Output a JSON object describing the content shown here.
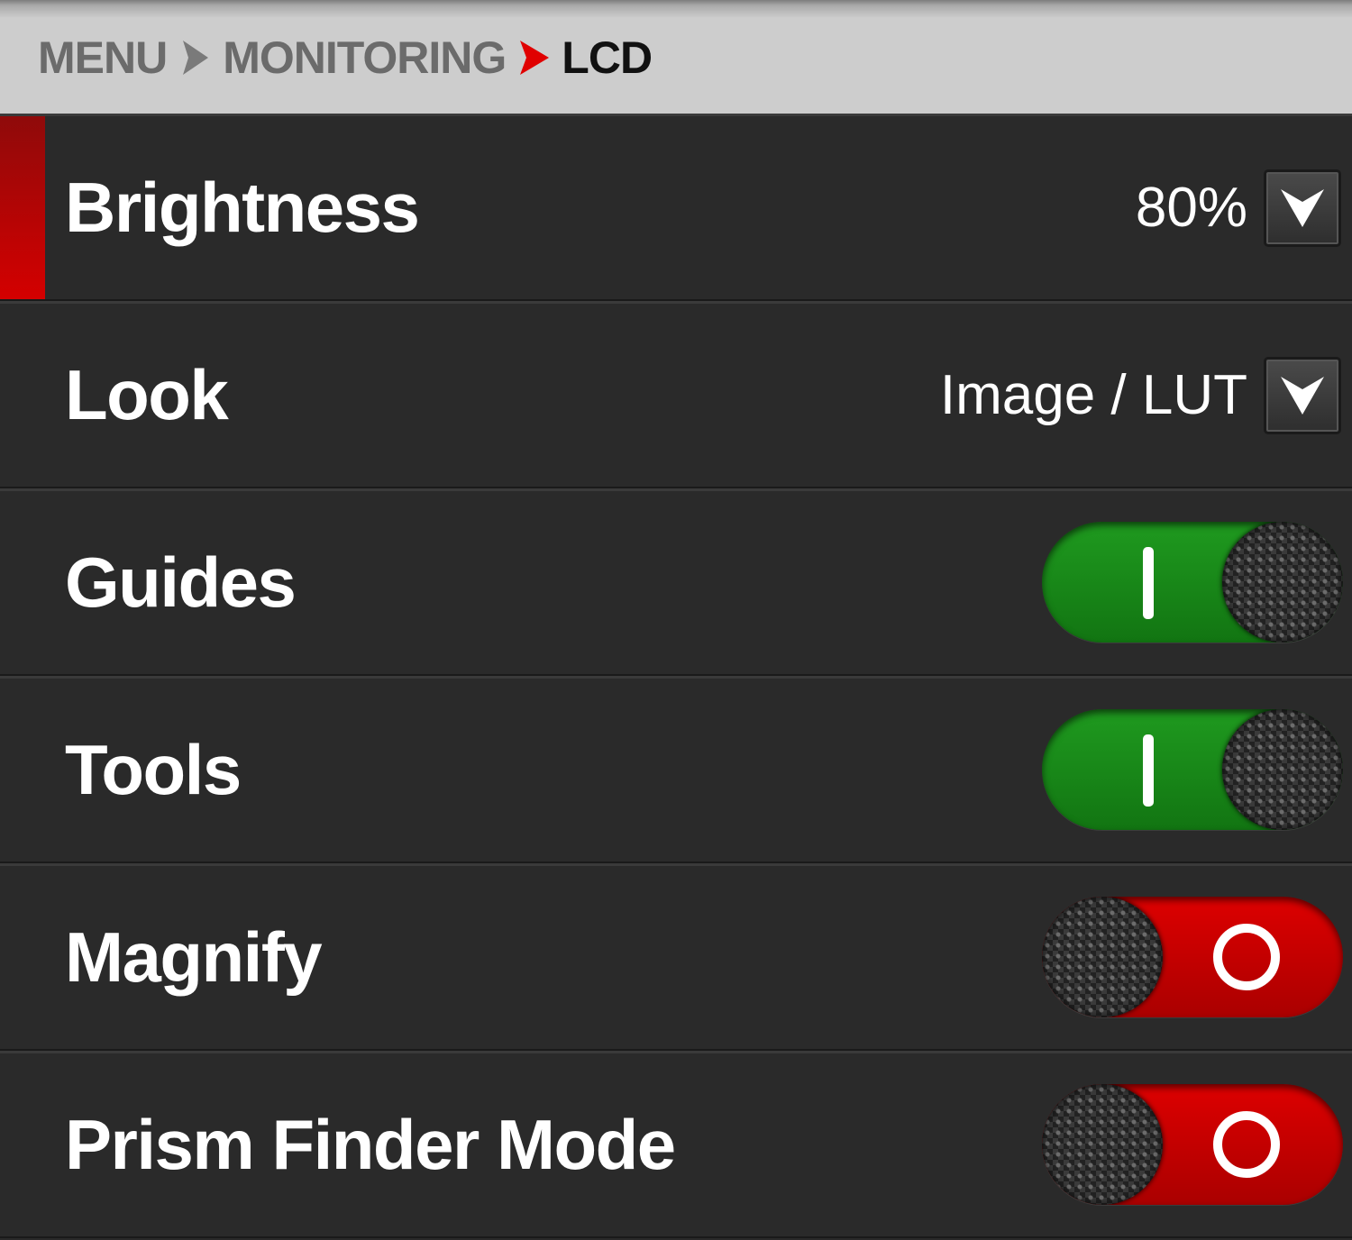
{
  "breadcrumb": {
    "items": [
      "MENU",
      "MONITORING",
      "LCD"
    ],
    "separator_icons": [
      "chevron-right-icon",
      "chevron-right-red-icon"
    ]
  },
  "colors": {
    "active_accent": "#d40000",
    "toggle_on": "#1a8a1a",
    "toggle_off": "#cc0000",
    "background": "#2a2a2a"
  },
  "settings": [
    {
      "label": "Brightness",
      "type": "dropdown",
      "value": "80%",
      "selected": true
    },
    {
      "label": "Look",
      "type": "dropdown",
      "value": "Image / LUT",
      "selected": false
    },
    {
      "label": "Guides",
      "type": "toggle",
      "state": "on"
    },
    {
      "label": "Tools",
      "type": "toggle",
      "state": "on"
    },
    {
      "label": "Magnify",
      "type": "toggle",
      "state": "off"
    },
    {
      "label": "Prism Finder Mode",
      "type": "toggle",
      "state": "off"
    }
  ]
}
